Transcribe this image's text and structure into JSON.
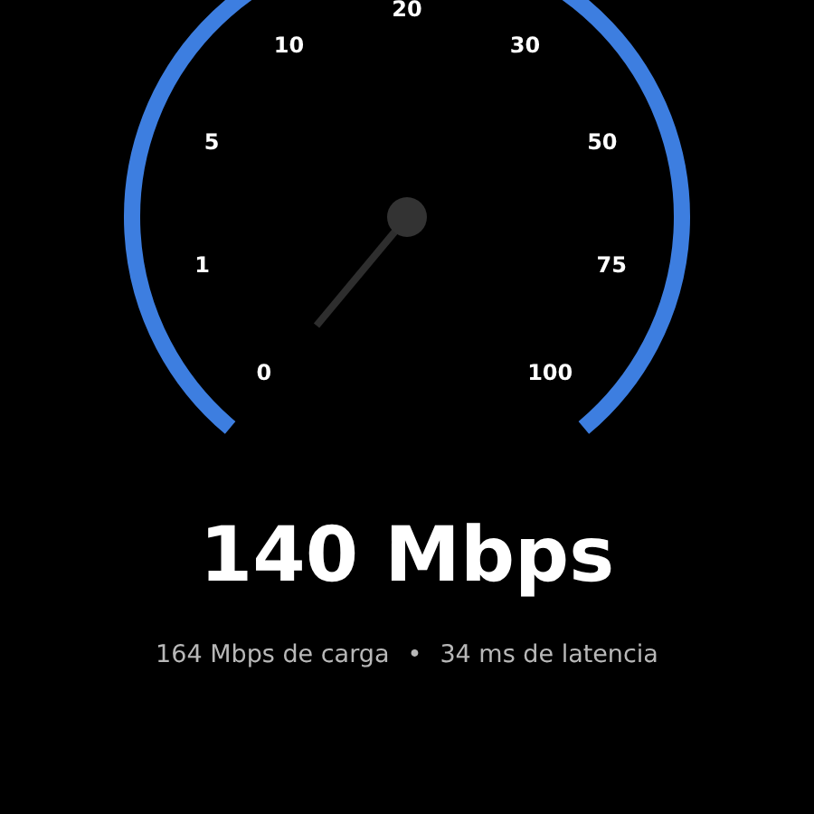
{
  "gauge": {
    "ticks": [
      "0",
      "1",
      "5",
      "10",
      "20",
      "30",
      "50",
      "75",
      "100"
    ]
  },
  "result": {
    "speed": "140 Mbps",
    "upload": "164 Mbps de carga",
    "separator": "•",
    "latency": "34 ms de latencia"
  }
}
